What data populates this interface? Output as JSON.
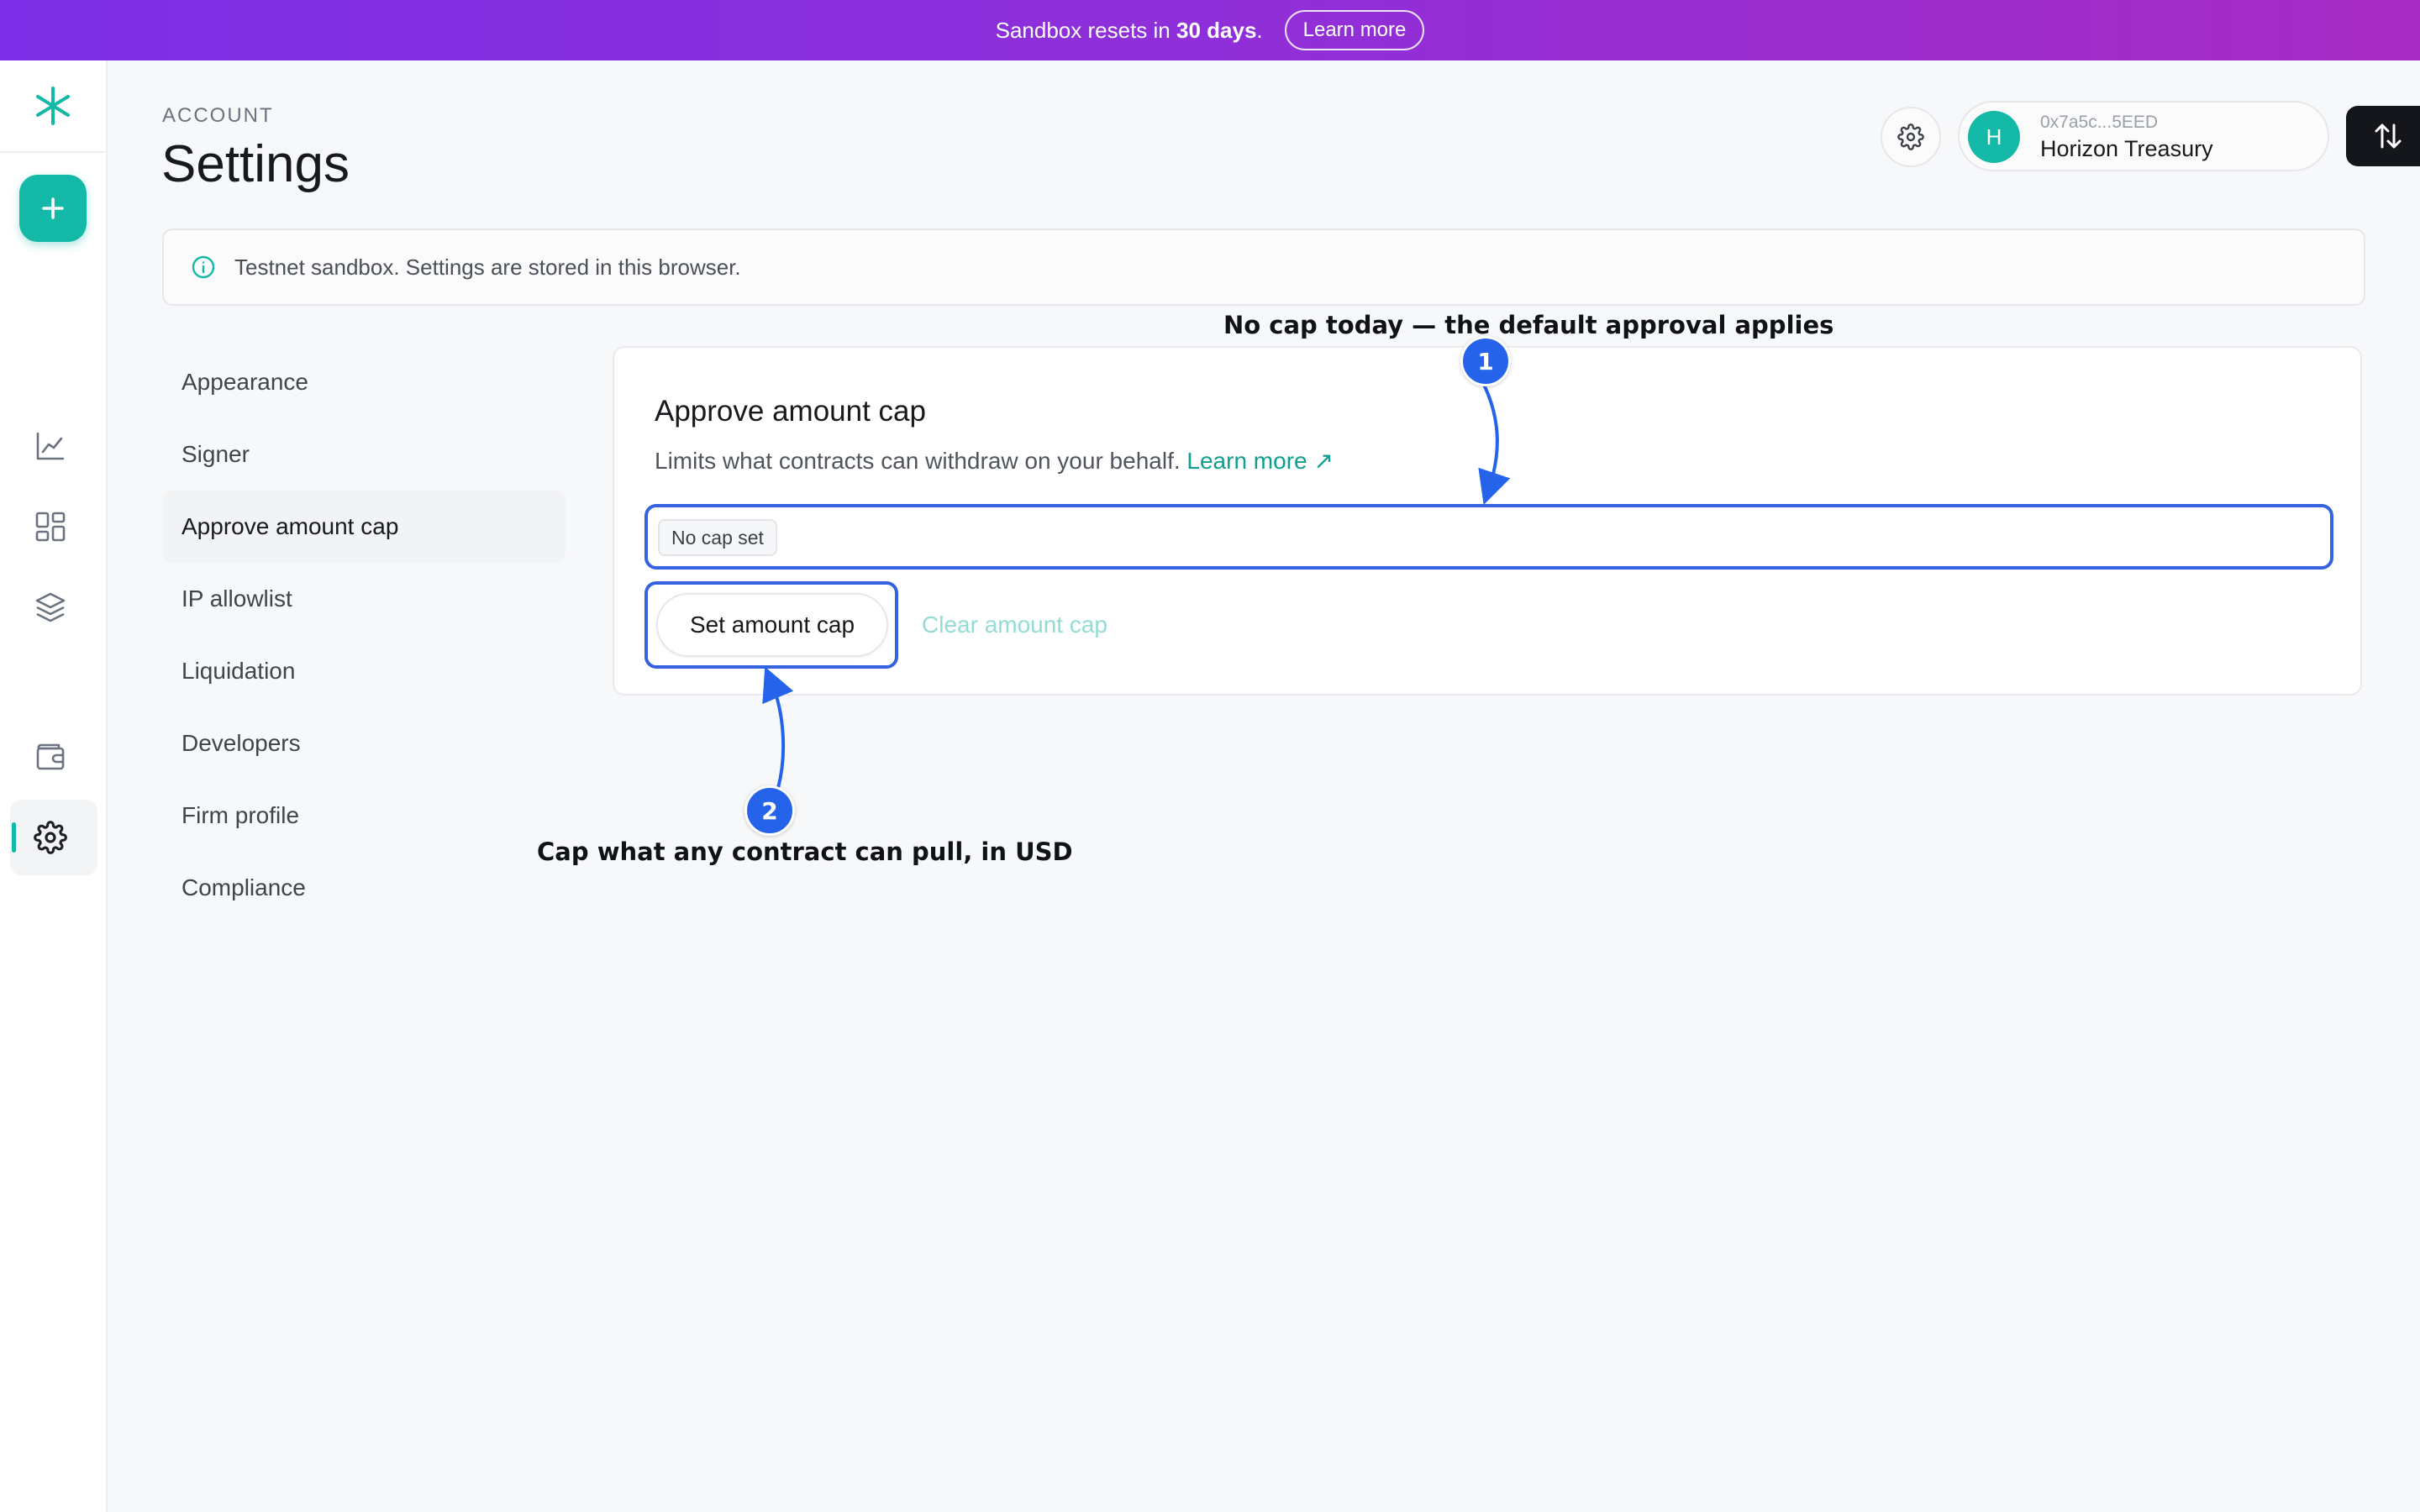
{
  "banner": {
    "prefix": "Sandbox resets in",
    "days": "30 days",
    "suffix": ".",
    "learn_more": "Learn more"
  },
  "header": {
    "eyebrow": "ACCOUNT",
    "title": "Settings"
  },
  "account": {
    "avatar_initial": "H",
    "address": "0x7a5c...5EED",
    "name": "Horizon Treasury"
  },
  "notice": {
    "icon": "info-icon",
    "text": "Testnet sandbox. Settings are stored in this browser."
  },
  "settings_nav": [
    {
      "label": "Appearance",
      "active": false
    },
    {
      "label": "Signer",
      "active": false
    },
    {
      "label": "Approve amount cap",
      "active": true
    },
    {
      "label": "IP allowlist",
      "active": false
    },
    {
      "label": "Liquidation",
      "active": false
    },
    {
      "label": "Developers",
      "active": false
    },
    {
      "label": "Firm profile",
      "active": false
    },
    {
      "label": "Compliance",
      "active": false
    }
  ],
  "card": {
    "title": "Approve amount cap",
    "description": "Limits what contracts can withdraw on your behalf.",
    "learn_more": "Learn more ↗",
    "cap_chip": "No cap set",
    "set_button": "Set amount cap",
    "clear_button": "Clear amount cap"
  },
  "annotations": {
    "one_number": "1",
    "one_text": "No cap today — the default approval applies",
    "two_number": "2",
    "two_text": "Cap what any contract can pull, in USD"
  },
  "rail_icons": [
    "asterisk-logo-icon",
    "plus-icon",
    "chart-line-icon",
    "dashboard-grid-icon",
    "layers-icon",
    "wallet-icon",
    "gear-icon"
  ],
  "colors": {
    "accent": "#14b8a6",
    "annotation": "#2563eb",
    "banner_start": "#7c2fe6",
    "banner_end": "#a72cc4"
  }
}
